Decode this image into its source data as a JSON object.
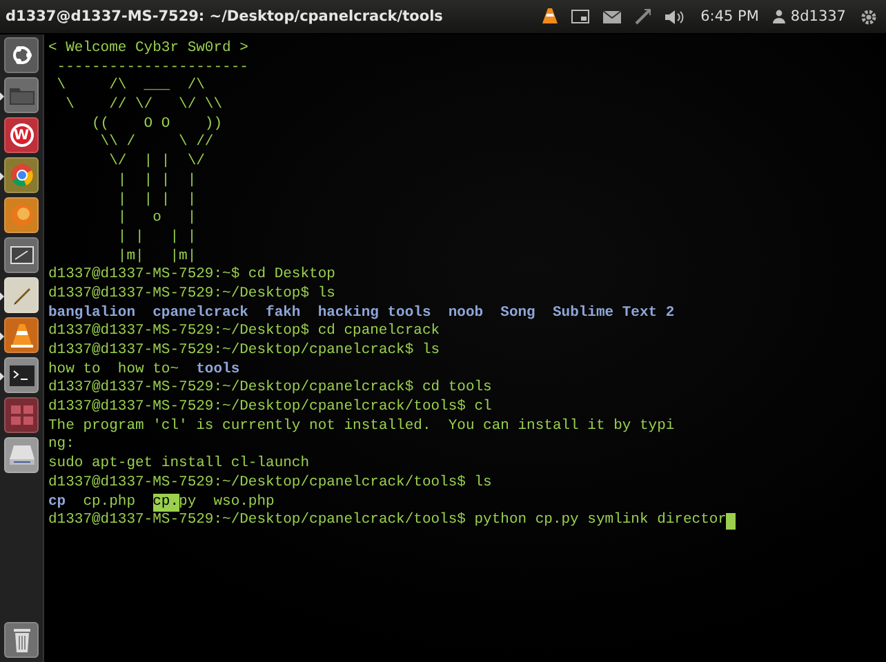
{
  "top_bar": {
    "title": "d1337@d1337-MS-7529: ~/Desktop/cpanelcrack/tools",
    "indicators": [
      {
        "kind": "cone"
      },
      {
        "kind": "screen"
      },
      {
        "kind": "mail"
      },
      {
        "kind": "network"
      },
      {
        "kind": "volume"
      }
    ],
    "clock": "6:45 PM",
    "user": "8d1337"
  },
  "launcher": [
    {
      "kind": "dash",
      "running": false
    },
    {
      "kind": "files",
      "running": true
    },
    {
      "kind": "letter",
      "letter": "W",
      "running": false
    },
    {
      "kind": "browser",
      "running": true
    },
    {
      "kind": "fox",
      "running": false
    },
    {
      "kind": "tablet",
      "running": false
    },
    {
      "kind": "editor",
      "running": true
    },
    {
      "kind": "cone",
      "running": true
    },
    {
      "kind": "terminal",
      "running": true
    },
    {
      "kind": "workspaces",
      "running": false
    },
    {
      "kind": "drive",
      "running": false
    }
  ],
  "trash": {
    "kind": "trash"
  },
  "terminal": {
    "lines": [
      {
        "kind": "banner",
        "text": "< Welcome Cyb3r Sw0rd >"
      },
      {
        "kind": "banner",
        "text": " ----------------------"
      },
      {
        "kind": "banner",
        "text": " \\     /\\  ___  /\\"
      },
      {
        "kind": "banner",
        "text": "  \\    // \\/   \\/ \\\\"
      },
      {
        "kind": "banner",
        "text": "     ((    O O    ))"
      },
      {
        "kind": "banner",
        "text": "      \\\\ /     \\ //"
      },
      {
        "kind": "banner",
        "text": "       \\/  | |  \\/"
      },
      {
        "kind": "banner",
        "text": "        |  | |  |"
      },
      {
        "kind": "banner",
        "text": "        |  | |  |"
      },
      {
        "kind": "banner",
        "text": "        |   o   |"
      },
      {
        "kind": "banner",
        "text": "        | |   | |"
      },
      {
        "kind": "banner",
        "text": "        |m|   |m|"
      },
      {
        "kind": "prompt",
        "prompt": "d1337@d1337-MS-7529:~$",
        "command": "cd Desktop"
      },
      {
        "kind": "prompt",
        "prompt": "d1337@d1337-MS-7529:~/Desktop$",
        "command": "ls"
      },
      {
        "kind": "listing",
        "entries": [
          {
            "text": "banglalion",
            "kind": "dir"
          },
          {
            "text": "cpanelcrack",
            "kind": "dir"
          },
          {
            "text": "fakh",
            "kind": "dir"
          },
          {
            "text": "hacking tools",
            "kind": "dir"
          },
          {
            "text": "noob",
            "kind": "dir"
          },
          {
            "text": "Song",
            "kind": "dir"
          },
          {
            "text": "Sublime Text 2",
            "kind": "dir"
          }
        ]
      },
      {
        "kind": "prompt",
        "prompt": "d1337@d1337-MS-7529:~/Desktop$",
        "command": "cd cpanelcrack"
      },
      {
        "kind": "prompt",
        "prompt": "d1337@d1337-MS-7529:~/Desktop/cpanelcrack$",
        "command": "ls"
      },
      {
        "kind": "listing",
        "entries": [
          {
            "text": "how to",
            "kind": "file"
          },
          {
            "text": "how to~",
            "kind": "file"
          },
          {
            "text": "tools",
            "kind": "dir"
          }
        ]
      },
      {
        "kind": "prompt",
        "prompt": "d1337@d1337-MS-7529:~/Desktop/cpanelcrack$",
        "command": "cd tools"
      },
      {
        "kind": "prompt",
        "prompt": "d1337@d1337-MS-7529:~/Desktop/cpanelcrack/tools$",
        "command": "cl"
      },
      {
        "kind": "output",
        "text": "The program 'cl' is currently not installed.  You can install it by typi"
      },
      {
        "kind": "output",
        "text": "ng:"
      },
      {
        "kind": "output",
        "text": "sudo apt-get install cl-launch"
      },
      {
        "kind": "prompt",
        "prompt": "d1337@d1337-MS-7529:~/Desktop/cpanelcrack/tools$",
        "command": "ls"
      },
      {
        "kind": "listing",
        "entries": [
          {
            "text": "cp",
            "kind": "dir"
          },
          {
            "text": "cp.php",
            "kind": "file"
          },
          {
            "kind": "file",
            "parts": [
              {
                "text": "cp.",
                "selected": true
              },
              {
                "text": "py",
                "selected": false
              }
            ]
          },
          {
            "text": "wso.php",
            "kind": "file"
          }
        ]
      },
      {
        "kind": "prompt",
        "prompt": "d1337@d1337-MS-7529:~/Desktop/cpanelcrack/tools$",
        "command": "python cp.py symlink director",
        "cursor": true
      }
    ]
  }
}
